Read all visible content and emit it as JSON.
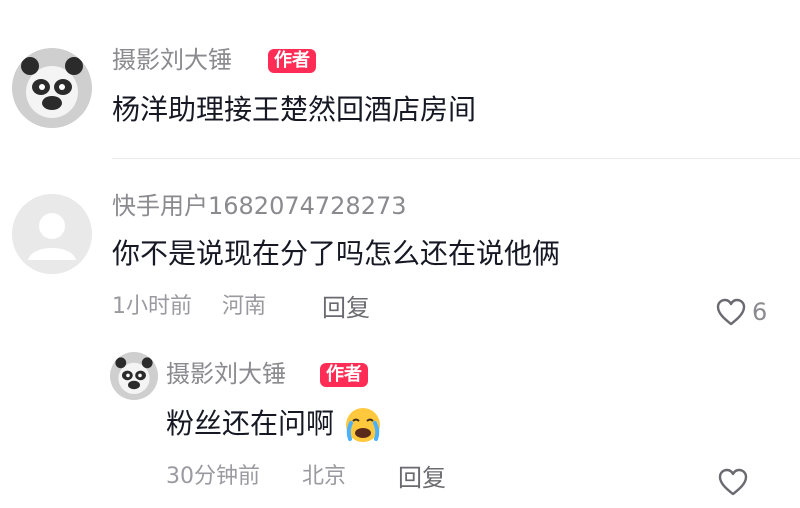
{
  "post": {
    "author": "摄影刘大锤",
    "badge": "作者",
    "text": "杨洋助理接王楚然回酒店房间"
  },
  "comment": {
    "author": "快手用户1682074728273",
    "text": "你不是说现在分了吗怎么还在说他俩",
    "time": "1小时前",
    "location": "河南",
    "reply_label": "回复",
    "likes": "6"
  },
  "reply": {
    "author": "摄影刘大锤",
    "badge": "作者",
    "text": "粉丝还在问啊",
    "emoji": "crying-face-emoji",
    "time": "30分钟前",
    "location": "北京",
    "reply_label": "回复"
  },
  "colors": {
    "badge": "#ff2d55",
    "text": "#161823",
    "muted": "#8a8a8f"
  }
}
